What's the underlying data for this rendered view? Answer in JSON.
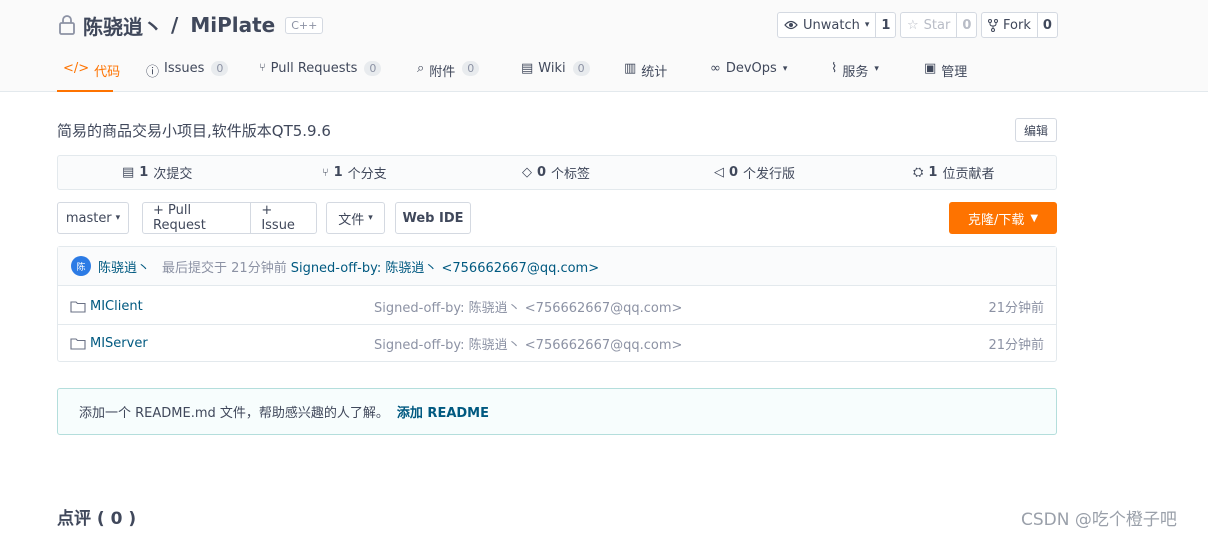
{
  "repo": {
    "owner": "陈骁逍丶",
    "separator": "/",
    "name": "MiPlate",
    "language": "C++"
  },
  "header_buttons": {
    "watch": {
      "label": "Unwatch",
      "count": "1",
      "icon": "eye-icon"
    },
    "star": {
      "label": "Star",
      "count": "0",
      "icon": "star-icon"
    },
    "fork": {
      "label": "Fork",
      "count": "0",
      "icon": "fork-icon"
    }
  },
  "tabs": [
    {
      "label": "代码",
      "icon": "code-icon",
      "active": true
    },
    {
      "label": "Issues",
      "badge": "0",
      "icon": "issue-icon"
    },
    {
      "label": "Pull Requests",
      "badge": "0",
      "icon": "pull-request-icon"
    },
    {
      "label": "附件",
      "badge": "0",
      "icon": "attachment-icon"
    },
    {
      "label": "Wiki",
      "badge": "0",
      "icon": "wiki-icon"
    },
    {
      "label": "统计",
      "icon": "chart-icon"
    },
    {
      "label": "DevOps",
      "icon": "devops-icon",
      "dropdown": true
    },
    {
      "label": "服务",
      "icon": "service-icon",
      "dropdown": true
    },
    {
      "label": "管理",
      "icon": "manage-icon"
    }
  ],
  "description": "简易的商品交易小项目,软件版本QT5.9.6",
  "edit_label": "编辑",
  "stats": [
    {
      "count": "1",
      "label": "次提交",
      "icon": "commit-icon"
    },
    {
      "count": "1",
      "label": "个分支",
      "icon": "branch-icon"
    },
    {
      "count": "0",
      "label": "个标签",
      "icon": "tag-icon"
    },
    {
      "count": "0",
      "label": "个发行版",
      "icon": "release-icon"
    },
    {
      "count": "1",
      "label": "位贡献者",
      "icon": "contributors-icon"
    }
  ],
  "toolbar": {
    "branch": "master",
    "pull_request": "+ Pull Request",
    "issue": "+ Issue",
    "file": "文件",
    "web_ide": "Web IDE",
    "clone": "克隆/下载"
  },
  "last_commit": {
    "avatar_text": "陈",
    "author": "陈骁逍丶",
    "meta": "最后提交于 21分钟前",
    "message": "Signed-off-by: 陈骁逍丶  <756662667@qq.com>"
  },
  "files": [
    {
      "name": "MIClient",
      "message": "Signed-off-by: 陈骁逍丶  <756662667@qq.com>",
      "time": "21分钟前"
    },
    {
      "name": "MIServer",
      "message": "Signed-off-by: 陈骁逍丶  <756662667@qq.com>",
      "time": "21分钟前"
    }
  ],
  "readme": {
    "tip": "添加一个 README.md 文件，帮助感兴趣的人了解。",
    "link": "添加 README"
  },
  "comments": "点评 ( 0 )",
  "watermark": "CSDN @吃个橙子吧",
  "colors": {
    "accent": "#fe7300",
    "link": "#005980",
    "text": "#40485b"
  }
}
